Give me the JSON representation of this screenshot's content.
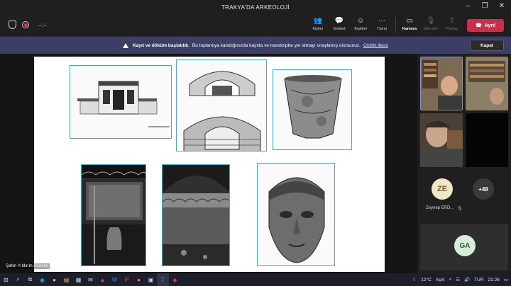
{
  "window": {
    "title": "TRAKYA'DA ARKEOLOJİ"
  },
  "toolbar": {
    "timer": "--:--",
    "buttons": [
      {
        "label": "Kişiler",
        "icon": "people-icon",
        "glyph": "👥"
      },
      {
        "label": "Sohbet",
        "icon": "chat-icon",
        "glyph": "💬"
      },
      {
        "label": "Tepkiler",
        "icon": "reactions-icon",
        "glyph": "☺"
      },
      {
        "label": "Tümü",
        "icon": "more-icon",
        "glyph": "⋯"
      },
      {
        "label": "Kamera",
        "icon": "camera-icon",
        "glyph": "▭"
      },
      {
        "label": "Mikrofon",
        "icon": "microphone-icon",
        "glyph": "🎙"
      },
      {
        "label": "Paylaş",
        "icon": "share-icon",
        "glyph": "⇧"
      }
    ],
    "leave_label": "Ayrıl"
  },
  "banner": {
    "bold": "Kayıt ve döküm başlatıldı.",
    "text": "Bu toplantıya katıldığınızda kayıtta ve transkriptte yer almayı onaylamış olursunuz.",
    "link": "Gizlilik ilkesi",
    "close_label": "Kapat"
  },
  "presenter": {
    "name": "Şahin Yıldırım (Konuk)"
  },
  "participants": {
    "ze_initials": "ZE",
    "ze_name": "Zeynep ERD...",
    "overflow": "+48",
    "ga_initials": "GA"
  },
  "colors": {
    "accent": "#c4314b",
    "banner": "#3d3e66",
    "ze_avatar": "#f0e6c8",
    "ga_avatar": "#d7ecd9"
  },
  "taskbar": {
    "weather": "12°C",
    "weather_label": "Açık",
    "language": "TUR",
    "time": "21:26"
  }
}
